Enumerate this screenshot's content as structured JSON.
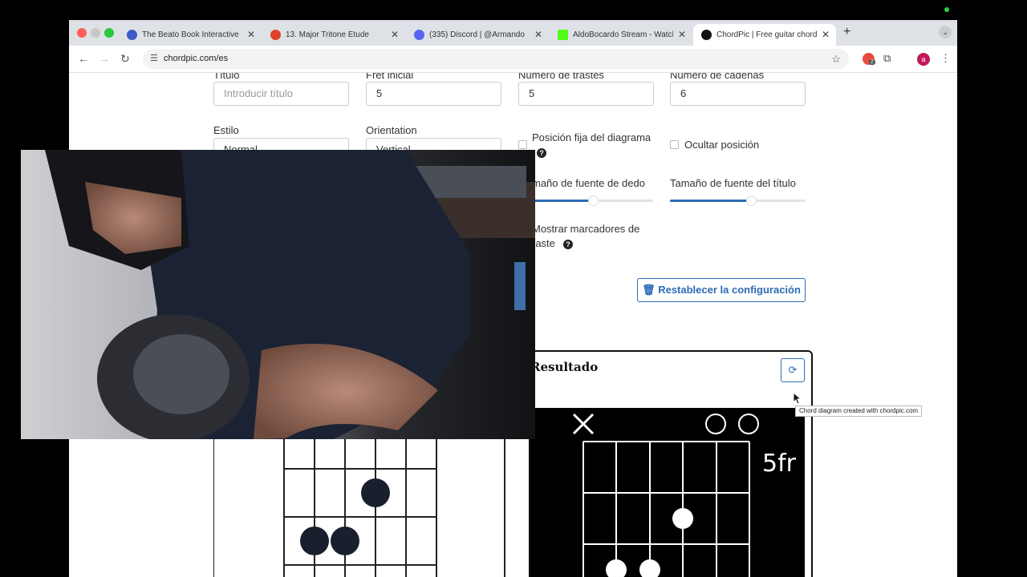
{
  "browser": {
    "tabs": [
      {
        "title": "The Beato Book Interactive",
        "icon": "beato-icon",
        "color": "#3b5cc5"
      },
      {
        "title": "13. Major Tritone Etude",
        "icon": "youtube-play-icon",
        "color": "#e0412a"
      },
      {
        "title": "(335) Discord | @Armando",
        "icon": "discord-icon",
        "color": "#5865f2"
      },
      {
        "title": "AldoBocardo Stream - Watch",
        "icon": "kick-icon",
        "color": "#53fc18"
      },
      {
        "title": "ChordPic | Free guitar chord d",
        "icon": "chordpic-icon",
        "color": "#111111"
      }
    ],
    "new_tab": "+",
    "url": "chordpic.com/es",
    "extension_badge": "2",
    "profile_initial": "a"
  },
  "form": {
    "title_label": "Título",
    "title_placeholder": "Introducir título",
    "fret_label": "Fret inicial",
    "fret_value": "5",
    "frets_label": "Número de trastes",
    "frets_value": "5",
    "strings_label": "Número de cadenas",
    "strings_value": "6",
    "style_label": "Estilo",
    "style_value": "Normal",
    "orientation_label": "Orientation",
    "orientation_value": "Vertical",
    "fixed_position_label": "Posición fija del diagrama",
    "hide_position_label": "Ocultar posición",
    "finger_font_label": "maño de fuente de dedo",
    "title_font_label": "Tamaño de fuente del título",
    "finger_font_level": 0.5,
    "title_font_level": 0.6,
    "show_markers_label_1": "Mostrar marcadores de",
    "show_markers_label_2": "raste",
    "reset_button": "Restablecer la configuración"
  },
  "result": {
    "title": "Resultado",
    "fret_label": "5fr",
    "tooltip": "Chord diagram created with chordpic.com"
  },
  "colors": {
    "accent": "#2d6bb5"
  }
}
